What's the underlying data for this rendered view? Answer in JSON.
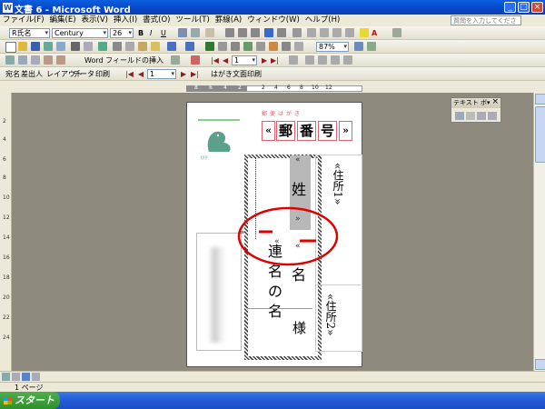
{
  "window": {
    "title": "文書 6 - Microsoft Word",
    "minimize_glyph": "_",
    "maximize_glyph": "□",
    "close_glyph": "×"
  },
  "menu": {
    "items": [
      "ファイル(F)",
      "編集(E)",
      "表示(V)",
      "挿入(I)",
      "書式(O)",
      "ツール(T)",
      "罫線(A)",
      "ウィンドウ(W)",
      "ヘルプ(H)"
    ],
    "help_placeholder": "質問を入力してください"
  },
  "format_toolbar": {
    "style": "R氏名",
    "font": "Century",
    "size": "26"
  },
  "standard_toolbar": {
    "zoom": "87%"
  },
  "mailmerge_toolbar": {
    "insert_merge_field": "Word フィールドの挿入",
    "record": "1"
  },
  "postcard_toolbar": {
    "items": [
      "宛名",
      "差出人",
      "レイアウト",
      "データ",
      "印刷"
    ],
    "record": "1",
    "print_button": "はがき文面印刷"
  },
  "ruler": {
    "h_ticks": [
      "8",
      "6",
      "4",
      "2",
      "",
      "2",
      "4",
      "6",
      "8",
      "10",
      "12"
    ],
    "v_ticks": [
      "2",
      "4",
      "6",
      "8",
      "10",
      "12",
      "14",
      "16",
      "18",
      "20",
      "22",
      "24"
    ]
  },
  "textbox_toolbar": {
    "title": "テキスト ボ▾"
  },
  "postcard": {
    "header_hint": "郵便はがき",
    "postal": [
      "«",
      "郵",
      "番",
      "号",
      "»"
    ],
    "sender_field": "住所1",
    "sender_field2": "住所2",
    "recipient_chars": [
      "姓",
      "名"
    ],
    "joint_chars": [
      "連",
      "名",
      "の",
      "名"
    ],
    "honorific": "様",
    "stamp_text": "切手"
  },
  "status": {
    "page": "1 ページ"
  },
  "taskbar": {
    "start": "スタート"
  },
  "colors": {
    "title": "#0a46c8",
    "annotation": "#e00000",
    "highlight": "#b8b8b8"
  }
}
